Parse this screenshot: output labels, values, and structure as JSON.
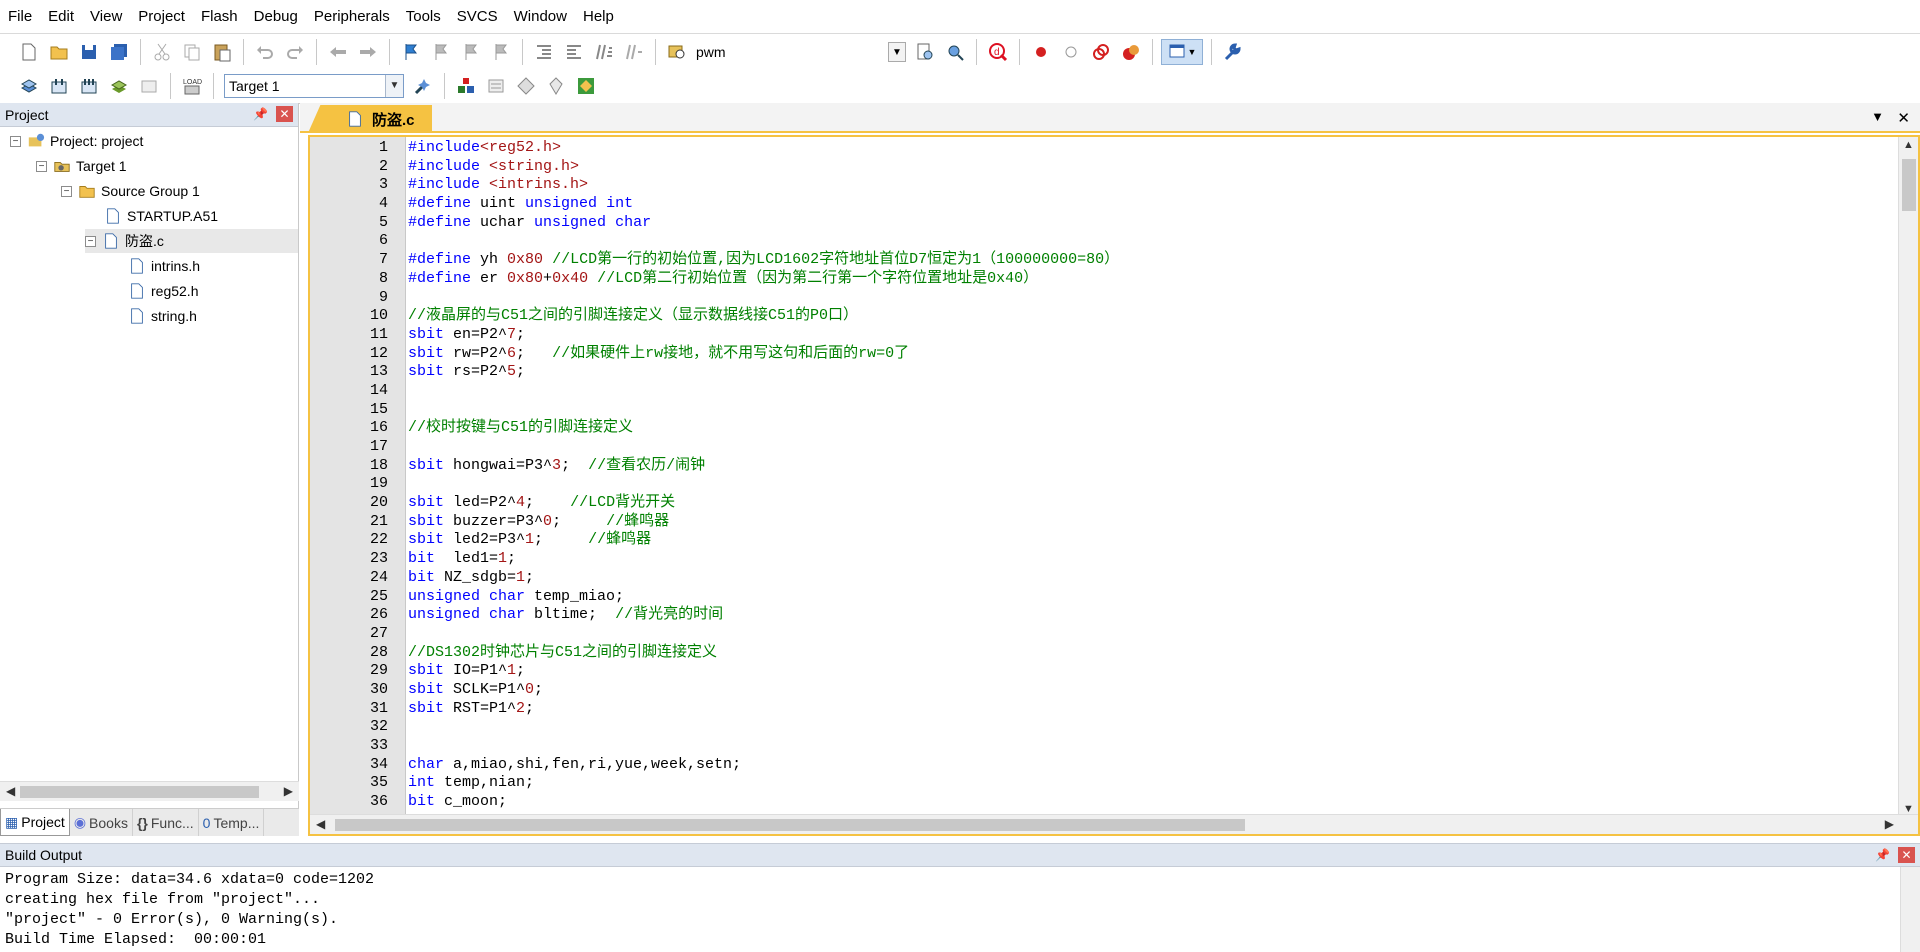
{
  "menu": [
    "File",
    "Edit",
    "View",
    "Project",
    "Flash",
    "Debug",
    "Peripherals",
    "Tools",
    "SVCS",
    "Window",
    "Help"
  ],
  "toolbar": {
    "target_combo": "pwm",
    "target_select": "Target 1"
  },
  "project_panel": {
    "title": "Project",
    "tree": [
      {
        "label": "Project: project",
        "expander": "−"
      },
      {
        "label": "Target 1",
        "expander": "−"
      },
      {
        "label": "Source Group 1",
        "expander": "−"
      },
      {
        "label": "STARTUP.A51"
      },
      {
        "label": "防盗.c",
        "expander": "−"
      },
      {
        "label": "intrins.h"
      },
      {
        "label": "reg52.h"
      },
      {
        "label": "string.h"
      }
    ],
    "tabs": [
      "Project",
      "Books",
      "Func...",
      "Temp..."
    ]
  },
  "editor": {
    "tab": "防盗.c",
    "lines": [
      "#include<reg52.h>",
      "#include <string.h>",
      "#include <intrins.h>",
      "#define uint unsigned int",
      "#define uchar unsigned char",
      "",
      "#define yh 0x80 //LCD第一行的初始位置,因为LCD1602字符地址首位D7恒定为1（100000000=80）",
      "#define er 0x80+0x40 //LCD第二行初始位置（因为第二行第一个字符位置地址是0x40）",
      "",
      "//液晶屏的与C51之间的引脚连接定义（显示数据线接C51的P0口）",
      "sbit en=P2^7;",
      "sbit rw=P2^6;   //如果硬件上rw接地，就不用写这句和后面的rw=0了",
      "sbit rs=P2^5;",
      "",
      "",
      "//校时按键与C51的引脚连接定义",
      "",
      "sbit hongwai=P3^3;  //查看农历/闹钟",
      "",
      "sbit led=P2^4;    //LCD背光开关",
      "sbit buzzer=P3^0;     //蜂鸣器",
      "sbit led2=P3^1;     //蜂鸣器",
      "bit  led1=1;",
      "bit NZ_sdgb=1;",
      "unsigned char temp_miao;",
      "unsigned char bltime;  //背光亮的时间",
      "",
      "//DS1302时钟芯片与C51之间的引脚连接定义",
      "sbit IO=P1^1;",
      "sbit SCLK=P1^0;",
      "sbit RST=P1^2;",
      "",
      "",
      "char a,miao,shi,fen,ri,yue,week,setn;",
      "int temp,nian;",
      "bit c_moon;"
    ]
  },
  "build_output": {
    "title": "Build Output",
    "lines": [
      "Program Size: data=34.6 xdata=0 code=1202",
      "creating hex file from \"project\"...",
      "\"project\" - 0 Error(s), 0 Warning(s).",
      "Build Time Elapsed:  00:00:01"
    ]
  }
}
